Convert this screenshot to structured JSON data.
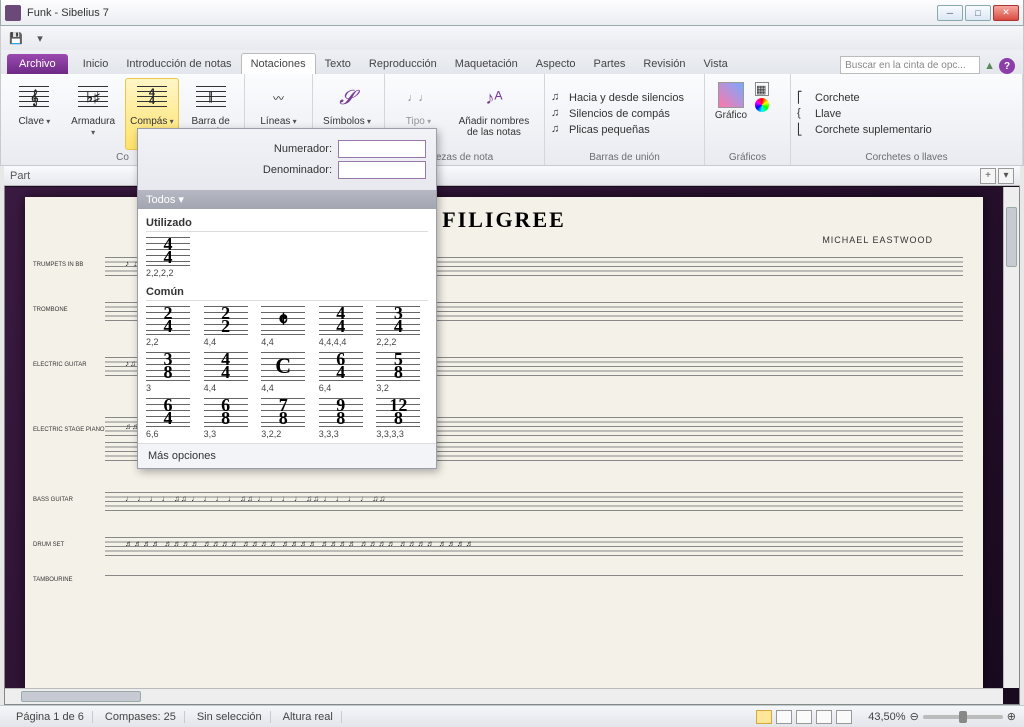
{
  "window": {
    "title": "Funk - Sibelius 7"
  },
  "tabs": {
    "file": "Archivo",
    "items": [
      "Inicio",
      "Introducción de notas",
      "Notaciones",
      "Texto",
      "Reproducción",
      "Maquetación",
      "Aspecto",
      "Partes",
      "Revisión",
      "Vista"
    ],
    "active_index": 2,
    "search_placeholder": "Buscar en la cinta de opc..."
  },
  "ribbon": {
    "groups": {
      "g1": {
        "clave": "Clave",
        "armadura": "Armadura",
        "compas": "Compás",
        "barra": "Barra de compás",
        "label": "Co"
      },
      "g2": {
        "lineas": "Líneas",
        "label": ""
      },
      "g3": {
        "simbolos": "Símbolos",
        "label": ""
      },
      "g4": {
        "tipo": "Tipo",
        "anadir": "Añadir nombres de las notas",
        "label": "ezas de nota"
      },
      "g5": {
        "i1": "Hacia y desde silencios",
        "i2": "Silencios de compás",
        "i3": "Plicas pequeñas",
        "label": "Barras de unión"
      },
      "g6": {
        "grafico": "Gráfico",
        "label": "Gráficos"
      },
      "g7": {
        "i1": "Corchete",
        "i2": "Llave",
        "i3": "Corchete suplementario",
        "label": "Corchetes o llaves"
      }
    }
  },
  "doc_tabs": {
    "left": "Part"
  },
  "dropdown": {
    "numerador_label": "Numerador:",
    "denominador_label": "Denominador:",
    "numerador": "",
    "denominador": "",
    "todos": "Todos",
    "utilizado": "Utilizado",
    "comun": "Común",
    "used": [
      {
        "sig": "4/4",
        "cap": "2,2,2,2"
      }
    ],
    "common": [
      {
        "sig": "2/4",
        "cap": "2,2"
      },
      {
        "sig": "2/2",
        "cap": "4,4"
      },
      {
        "sig": "𝄵",
        "cap": "4,4"
      },
      {
        "sig": "4/4",
        "cap": "4,4,4,4"
      },
      {
        "sig": "3/4",
        "cap": "2,2,2"
      },
      {
        "sig": "3/8",
        "cap": "3"
      },
      {
        "sig": "4/4",
        "cap": "4,4"
      },
      {
        "sig": "C",
        "cap": "4,4"
      },
      {
        "sig": "6/4",
        "cap": "6,4"
      },
      {
        "sig": "5/8",
        "cap": "3,2"
      },
      {
        "sig": "6/4",
        "cap": "6,6"
      },
      {
        "sig": "6/8",
        "cap": "3,3"
      },
      {
        "sig": "7/8",
        "cap": "3,2,2"
      },
      {
        "sig": "9/8",
        "cap": "3,3,3"
      },
      {
        "sig": "12/8",
        "cap": "3,3,3,3"
      }
    ],
    "mas": "Más opciones"
  },
  "score": {
    "title": "FILIGREE",
    "composer": "MICHAEL EASTWOOD",
    "instruments": [
      "Trumpets in Bb",
      "Trombone",
      "Electric Guitar",
      "Electric Stage Piano",
      "Bass Guitar",
      "Drum Set",
      "Tambourine"
    ]
  },
  "status": {
    "pagina": "Página 1 de 6",
    "compases": "Compases: 25",
    "seleccion": "Sin selección",
    "altura": "Altura real",
    "zoom": "43,50%"
  }
}
